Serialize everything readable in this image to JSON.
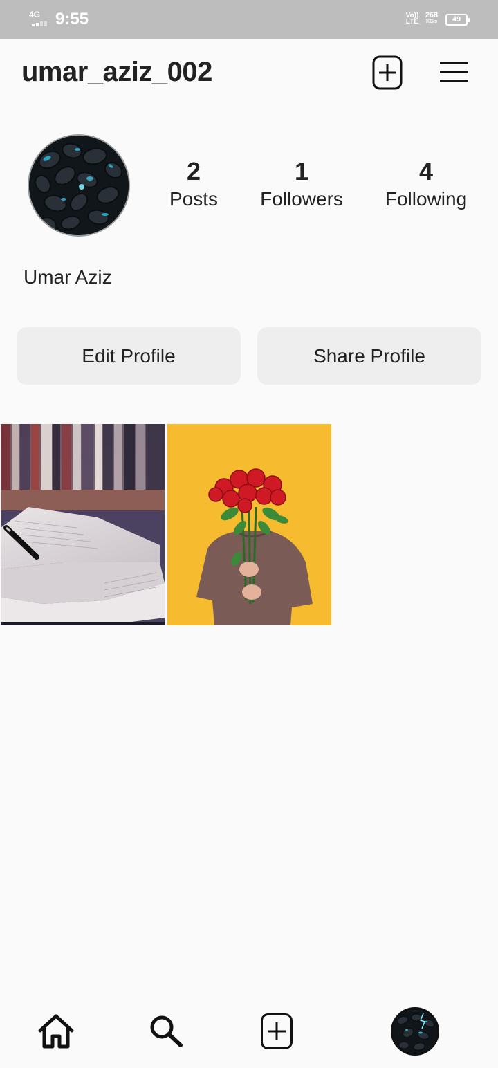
{
  "status_bar": {
    "network": "4G",
    "time": "9:55",
    "volte_top": "Vo))",
    "volte_bottom": "LTE",
    "speed_value": "268",
    "speed_unit": "KB/s",
    "battery": "49"
  },
  "header": {
    "username": "umar_aziz_002",
    "new_post_icon": "add-square-icon",
    "menu_icon": "hamburger-menu-icon"
  },
  "profile": {
    "display_name": "Umar Aziz",
    "avatar": "dark-pebbles-blue-glow-avatar",
    "stats": {
      "posts": {
        "value": "2",
        "label": "Posts"
      },
      "followers": {
        "value": "1",
        "label": "Followers"
      },
      "following": {
        "value": "4",
        "label": "Following"
      }
    }
  },
  "actions": {
    "edit_label": "Edit Profile",
    "share_label": "Share Profile"
  },
  "posts": [
    {
      "image": "open-book-with-pen-bookshelf"
    },
    {
      "image": "person-holding-red-roses-yellow-background"
    }
  ],
  "bottom_nav": {
    "items": [
      "home-icon",
      "search-icon",
      "add-post-icon",
      "profile-avatar"
    ]
  },
  "colors": {
    "background": "#fafafa",
    "status_bar": "#bdbdbd",
    "button_bg": "#eeeeee",
    "text": "#222222"
  }
}
